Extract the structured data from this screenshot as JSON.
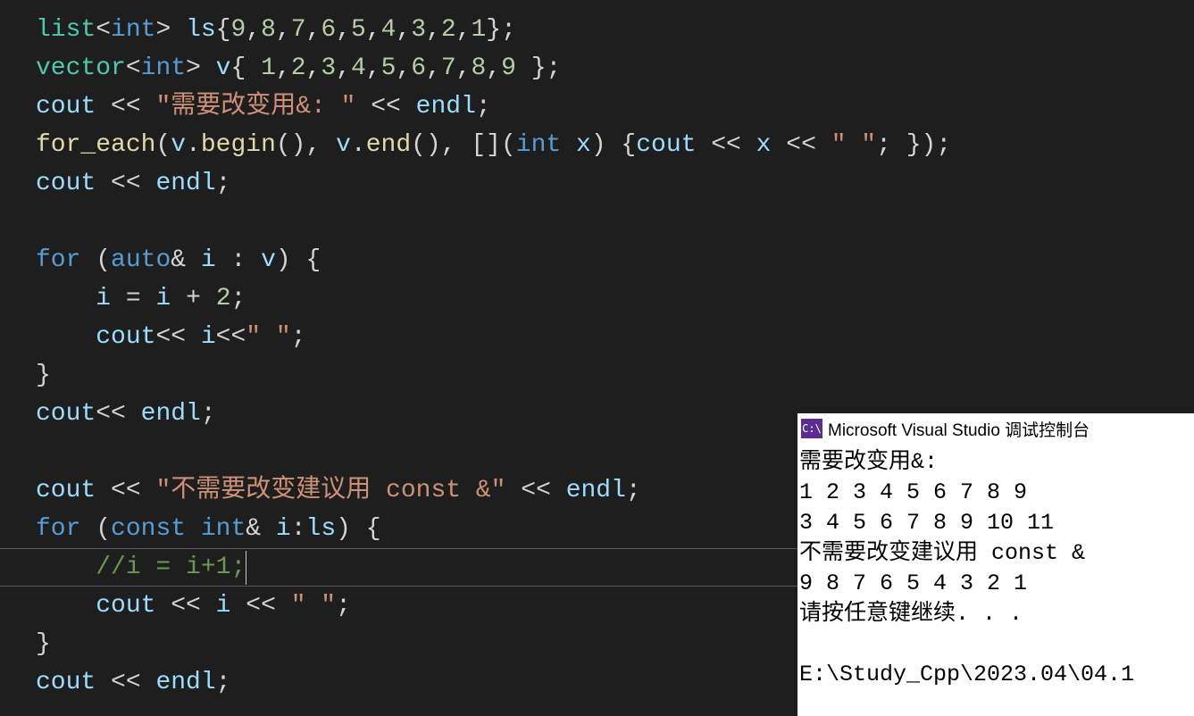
{
  "code": {
    "lines": [
      [
        {
          "cls": "tok-type",
          "t": "list"
        },
        {
          "cls": "tok-punct",
          "t": "<"
        },
        {
          "cls": "tok-kw",
          "t": "int"
        },
        {
          "cls": "tok-punct",
          "t": "> "
        },
        {
          "cls": "tok-var",
          "t": "ls"
        },
        {
          "cls": "tok-punct",
          "t": "{"
        },
        {
          "cls": "tok-num",
          "t": "9"
        },
        {
          "cls": "tok-punct",
          "t": ","
        },
        {
          "cls": "tok-num",
          "t": "8"
        },
        {
          "cls": "tok-punct",
          "t": ","
        },
        {
          "cls": "tok-num",
          "t": "7"
        },
        {
          "cls": "tok-punct",
          "t": ","
        },
        {
          "cls": "tok-num",
          "t": "6"
        },
        {
          "cls": "tok-punct",
          "t": ","
        },
        {
          "cls": "tok-num",
          "t": "5"
        },
        {
          "cls": "tok-punct",
          "t": ","
        },
        {
          "cls": "tok-num",
          "t": "4"
        },
        {
          "cls": "tok-punct",
          "t": ","
        },
        {
          "cls": "tok-num",
          "t": "3"
        },
        {
          "cls": "tok-punct",
          "t": ","
        },
        {
          "cls": "tok-num",
          "t": "2"
        },
        {
          "cls": "tok-punct",
          "t": ","
        },
        {
          "cls": "tok-num",
          "t": "1"
        },
        {
          "cls": "tok-punct",
          "t": "};"
        }
      ],
      [
        {
          "cls": "tok-type",
          "t": "vector"
        },
        {
          "cls": "tok-punct",
          "t": "<"
        },
        {
          "cls": "tok-kw",
          "t": "int"
        },
        {
          "cls": "tok-punct",
          "t": "> "
        },
        {
          "cls": "tok-var",
          "t": "v"
        },
        {
          "cls": "tok-punct",
          "t": "{ "
        },
        {
          "cls": "tok-num",
          "t": "1"
        },
        {
          "cls": "tok-punct",
          "t": ","
        },
        {
          "cls": "tok-num",
          "t": "2"
        },
        {
          "cls": "tok-punct",
          "t": ","
        },
        {
          "cls": "tok-num",
          "t": "3"
        },
        {
          "cls": "tok-punct",
          "t": ","
        },
        {
          "cls": "tok-num",
          "t": "4"
        },
        {
          "cls": "tok-punct",
          "t": ","
        },
        {
          "cls": "tok-num",
          "t": "5"
        },
        {
          "cls": "tok-punct",
          "t": ","
        },
        {
          "cls": "tok-num",
          "t": "6"
        },
        {
          "cls": "tok-punct",
          "t": ","
        },
        {
          "cls": "tok-num",
          "t": "7"
        },
        {
          "cls": "tok-punct",
          "t": ","
        },
        {
          "cls": "tok-num",
          "t": "8"
        },
        {
          "cls": "tok-punct",
          "t": ","
        },
        {
          "cls": "tok-num",
          "t": "9"
        },
        {
          "cls": "tok-punct",
          "t": " };"
        }
      ],
      [
        {
          "cls": "tok-var",
          "t": "cout"
        },
        {
          "cls": "tok-op",
          "t": " << "
        },
        {
          "cls": "tok-str",
          "t": "\"需要改变用&: \""
        },
        {
          "cls": "tok-op",
          "t": " << "
        },
        {
          "cls": "tok-var",
          "t": "endl"
        },
        {
          "cls": "tok-punct",
          "t": ";"
        }
      ],
      [
        {
          "cls": "tok-func",
          "t": "for_each"
        },
        {
          "cls": "tok-punct",
          "t": "("
        },
        {
          "cls": "tok-var",
          "t": "v"
        },
        {
          "cls": "tok-punct",
          "t": "."
        },
        {
          "cls": "tok-func",
          "t": "begin"
        },
        {
          "cls": "tok-punct",
          "t": "(), "
        },
        {
          "cls": "tok-var",
          "t": "v"
        },
        {
          "cls": "tok-punct",
          "t": "."
        },
        {
          "cls": "tok-func",
          "t": "end"
        },
        {
          "cls": "tok-punct",
          "t": "(), []("
        },
        {
          "cls": "tok-kw",
          "t": "int"
        },
        {
          "cls": "tok-default",
          "t": " "
        },
        {
          "cls": "tok-var",
          "t": "x"
        },
        {
          "cls": "tok-punct",
          "t": ") {"
        },
        {
          "cls": "tok-var",
          "t": "cout"
        },
        {
          "cls": "tok-op",
          "t": " << "
        },
        {
          "cls": "tok-var",
          "t": "x"
        },
        {
          "cls": "tok-op",
          "t": " << "
        },
        {
          "cls": "tok-str",
          "t": "\" \""
        },
        {
          "cls": "tok-punct",
          "t": "; });"
        }
      ],
      [
        {
          "cls": "tok-var",
          "t": "cout"
        },
        {
          "cls": "tok-op",
          "t": " << "
        },
        {
          "cls": "tok-var",
          "t": "endl"
        },
        {
          "cls": "tok-punct",
          "t": ";"
        }
      ],
      [],
      [
        {
          "cls": "tok-kw",
          "t": "for"
        },
        {
          "cls": "tok-punct",
          "t": " ("
        },
        {
          "cls": "tok-kw",
          "t": "auto"
        },
        {
          "cls": "tok-punct",
          "t": "& "
        },
        {
          "cls": "tok-var",
          "t": "i"
        },
        {
          "cls": "tok-punct",
          "t": " : "
        },
        {
          "cls": "tok-var",
          "t": "v"
        },
        {
          "cls": "tok-punct",
          "t": ") {"
        }
      ],
      [
        {
          "cls": "tok-default",
          "t": "    "
        },
        {
          "cls": "tok-var",
          "t": "i"
        },
        {
          "cls": "tok-op",
          "t": " = "
        },
        {
          "cls": "tok-var",
          "t": "i"
        },
        {
          "cls": "tok-op",
          "t": " + "
        },
        {
          "cls": "tok-num",
          "t": "2"
        },
        {
          "cls": "tok-punct",
          "t": ";"
        }
      ],
      [
        {
          "cls": "tok-default",
          "t": "    "
        },
        {
          "cls": "tok-var",
          "t": "cout"
        },
        {
          "cls": "tok-op",
          "t": "<< "
        },
        {
          "cls": "tok-var",
          "t": "i"
        },
        {
          "cls": "tok-op",
          "t": "<<"
        },
        {
          "cls": "tok-str",
          "t": "\" \""
        },
        {
          "cls": "tok-punct",
          "t": ";"
        }
      ],
      [
        {
          "cls": "tok-punct",
          "t": "}"
        }
      ],
      [
        {
          "cls": "tok-var",
          "t": "cout"
        },
        {
          "cls": "tok-op",
          "t": "<< "
        },
        {
          "cls": "tok-var",
          "t": "endl"
        },
        {
          "cls": "tok-punct",
          "t": ";"
        }
      ],
      [],
      [
        {
          "cls": "tok-var",
          "t": "cout"
        },
        {
          "cls": "tok-op",
          "t": " << "
        },
        {
          "cls": "tok-str",
          "t": "\"不需要改变建议用 const &\""
        },
        {
          "cls": "tok-op",
          "t": " << "
        },
        {
          "cls": "tok-var",
          "t": "endl"
        },
        {
          "cls": "tok-punct",
          "t": ";"
        }
      ],
      [
        {
          "cls": "tok-kw",
          "t": "for"
        },
        {
          "cls": "tok-punct",
          "t": " ("
        },
        {
          "cls": "tok-kw",
          "t": "const"
        },
        {
          "cls": "tok-default",
          "t": " "
        },
        {
          "cls": "tok-kw",
          "t": "int"
        },
        {
          "cls": "tok-punct",
          "t": "& "
        },
        {
          "cls": "tok-var",
          "t": "i"
        },
        {
          "cls": "tok-punct",
          "t": ":"
        },
        {
          "cls": "tok-var",
          "t": "ls"
        },
        {
          "cls": "tok-punct",
          "t": ") {"
        }
      ],
      [
        {
          "cls": "tok-default",
          "t": "    "
        },
        {
          "cls": "tok-comment",
          "t": "//i = i+1;"
        }
      ],
      [
        {
          "cls": "tok-default",
          "t": "    "
        },
        {
          "cls": "tok-var",
          "t": "cout"
        },
        {
          "cls": "tok-op",
          "t": " << "
        },
        {
          "cls": "tok-var",
          "t": "i"
        },
        {
          "cls": "tok-op",
          "t": " << "
        },
        {
          "cls": "tok-str",
          "t": "\" \""
        },
        {
          "cls": "tok-punct",
          "t": ";"
        }
      ],
      [
        {
          "cls": "tok-punct",
          "t": "}"
        }
      ],
      [
        {
          "cls": "tok-var",
          "t": "cout"
        },
        {
          "cls": "tok-op",
          "t": " << "
        },
        {
          "cls": "tok-var",
          "t": "endl"
        },
        {
          "cls": "tok-punct",
          "t": ";"
        }
      ]
    ],
    "currentLineIndex": 14
  },
  "console": {
    "iconText": "C:\\",
    "title": "Microsoft Visual Studio 调试控制台",
    "lines": [
      "需要改变用&:",
      "1 2 3 4 5 6 7 8 9",
      "3 4 5 6 7 8 9 10 11",
      "不需要改变建议用 const &",
      "9 8 7 6 5 4 3 2 1",
      "请按任意键继续. . .",
      "",
      "E:\\Study_Cpp\\2023.04\\04.1"
    ]
  }
}
